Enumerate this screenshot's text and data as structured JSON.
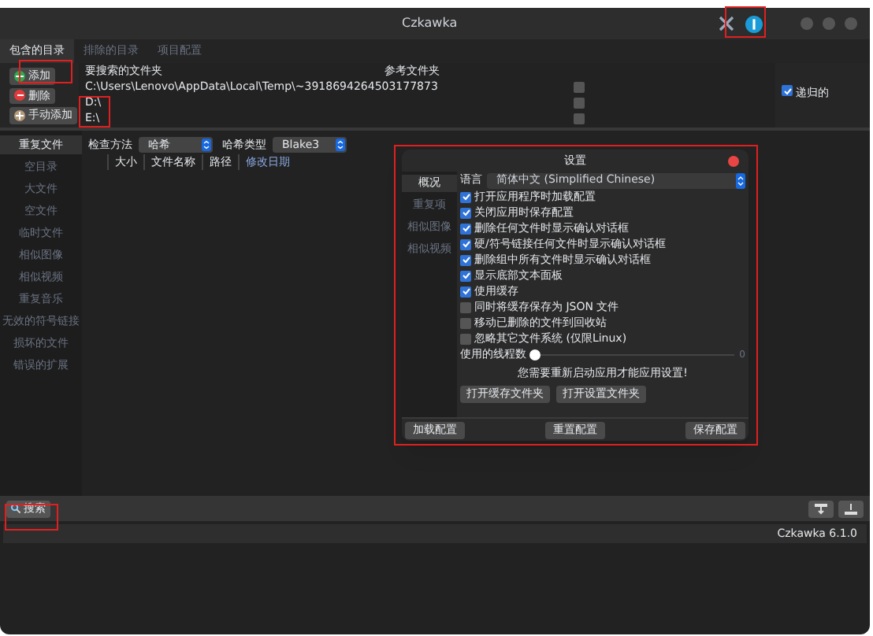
{
  "window": {
    "title": "Czkawka"
  },
  "tabs": [
    {
      "label": "包含的目录",
      "selected": true
    },
    {
      "label": "排除的目录",
      "selected": false
    },
    {
      "label": "项目配置",
      "selected": false
    }
  ],
  "dir_buttons": [
    {
      "label": "添加",
      "kind": "add"
    },
    {
      "label": "删除",
      "kind": "remove"
    },
    {
      "label": "手动添加",
      "kind": "manual"
    }
  ],
  "folders": {
    "columns": [
      "要搜索的文件夹",
      "参考文件夹"
    ],
    "rows": [
      {
        "path": "C:\\Users\\Lenovo\\AppData\\Local\\Temp\\~3918694264503177873",
        "reference": false
      },
      {
        "path": "D:\\",
        "reference": false
      },
      {
        "path": "E:\\",
        "reference": false
      }
    ]
  },
  "recursive": {
    "label": "递归的",
    "checked": true
  },
  "tools": [
    {
      "label": "重复文件",
      "selected": true
    },
    {
      "label": "空目录",
      "selected": false
    },
    {
      "label": "大文件",
      "selected": false
    },
    {
      "label": "空文件",
      "selected": false
    },
    {
      "label": "临时文件",
      "selected": false
    },
    {
      "label": "相似图像",
      "selected": false
    },
    {
      "label": "相似视频",
      "selected": false
    },
    {
      "label": "重复音乐",
      "selected": false
    },
    {
      "label": "无效的符号链接",
      "selected": false
    },
    {
      "label": "损坏的文件",
      "selected": false
    },
    {
      "label": "错误的扩展",
      "selected": false
    }
  ],
  "options": [
    {
      "label": "检查方法",
      "value": "哈希"
    },
    {
      "label": "哈希类型",
      "value": "Blake3"
    }
  ],
  "results": {
    "columns": [
      "大小",
      "文件名称",
      "路径",
      "修改日期"
    ]
  },
  "settings": {
    "title": "设置",
    "tabs": [
      {
        "label": "概况",
        "selected": true
      },
      {
        "label": "重复项",
        "selected": false
      },
      {
        "label": "相似图像",
        "selected": false
      },
      {
        "label": "相似视频",
        "selected": false
      }
    ],
    "language": {
      "label": "语言",
      "value": "简体中文 (Simplified Chinese)"
    },
    "checkboxes": [
      {
        "label": "打开应用程序时加载配置",
        "checked": true
      },
      {
        "label": "关闭应用时保存配置",
        "checked": true
      },
      {
        "label": "删除任何文件时显示确认对话框",
        "checked": true
      },
      {
        "label": "硬/符号链接任何文件时显示确认对话框",
        "checked": true
      },
      {
        "label": "删除组中所有文件时显示确认对话框",
        "checked": true
      },
      {
        "label": "显示底部文本面板",
        "checked": true
      },
      {
        "label": "使用缓存",
        "checked": true
      },
      {
        "label": "同时将缓存保存为 JSON 文件",
        "checked": false
      },
      {
        "label": "移动已删除的文件到回收站",
        "checked": false
      },
      {
        "label": "忽略其它文件系统 (仅限Linux)",
        "checked": false
      }
    ],
    "threads": {
      "label": "使用的线程数",
      "level": 0,
      "reading": "0"
    },
    "notice": "您需要重新启动应用才能应用设置!",
    "folder_buttons": [
      "打开缓存文件夹",
      "打开设置文件夹"
    ],
    "footer_buttons": [
      "加载配置",
      "重置配置",
      "保存配置"
    ]
  },
  "search_button": "搜索",
  "status_bar": "Czkawka 6.1.0"
}
